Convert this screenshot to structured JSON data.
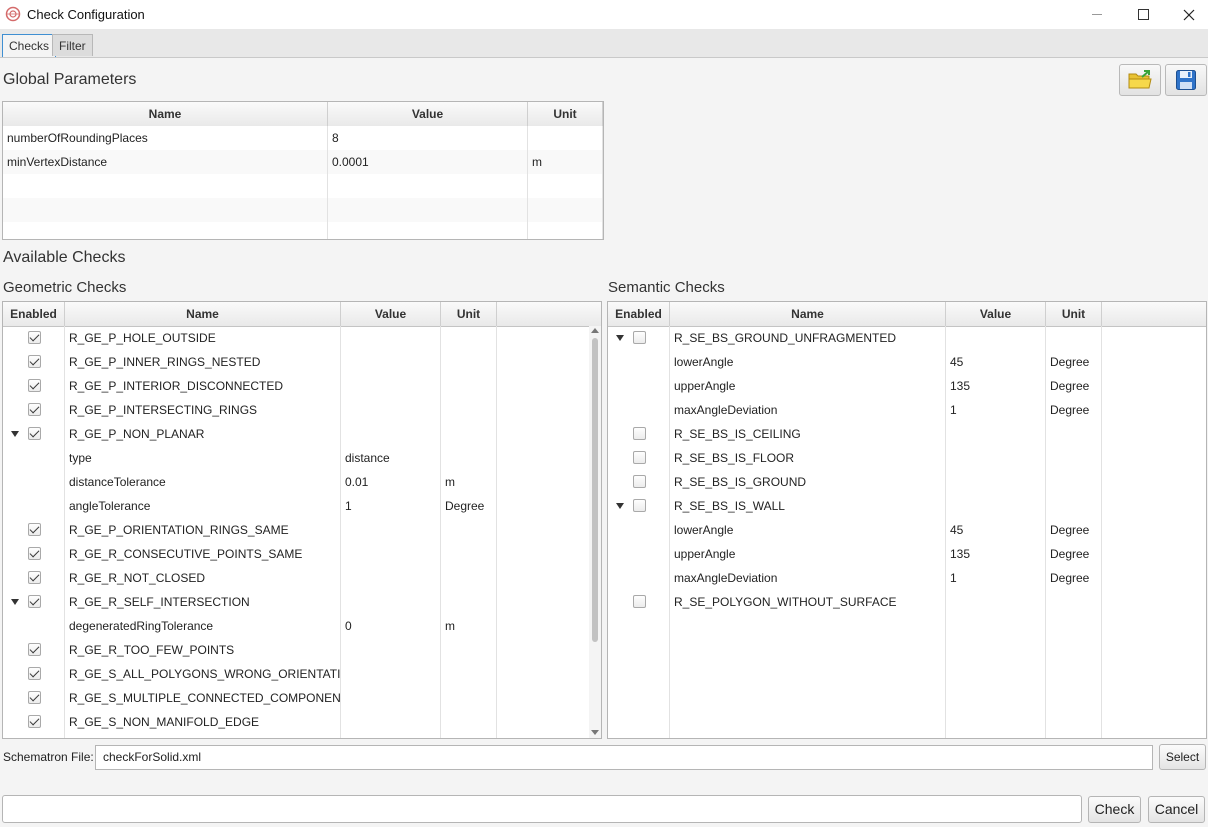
{
  "window": {
    "title": "Check Configuration",
    "minimize_icon": "minimize-icon",
    "maximize_icon": "maximize-icon",
    "close_icon": "close-icon"
  },
  "tabs": [
    {
      "label": "Checks",
      "active": true
    },
    {
      "label": "Filter",
      "active": false
    }
  ],
  "toolbar": {
    "open_icon": "folder-open-icon",
    "save_icon": "save-icon"
  },
  "global": {
    "title": "Global Parameters",
    "columns": [
      "Name",
      "Value",
      "Unit"
    ],
    "rows": [
      {
        "name": "numberOfRoundingPlaces",
        "value": "8",
        "unit": ""
      },
      {
        "name": "minVertexDistance",
        "value": "0.0001",
        "unit": "m"
      }
    ]
  },
  "available_title": "Available Checks",
  "geometric": {
    "title": "Geometric Checks",
    "columns": [
      "Enabled",
      "Name",
      "Value",
      "Unit"
    ],
    "rows": [
      {
        "kind": "check",
        "name": "R_GE_P_HOLE_OUTSIDE",
        "checked": true
      },
      {
        "kind": "check",
        "name": "R_GE_P_INNER_RINGS_NESTED",
        "checked": true
      },
      {
        "kind": "check",
        "name": "R_GE_P_INTERIOR_DISCONNECTED",
        "checked": true
      },
      {
        "kind": "check",
        "name": "R_GE_P_INTERSECTING_RINGS",
        "checked": true
      },
      {
        "kind": "check",
        "name": "R_GE_P_NON_PLANAR",
        "checked": true,
        "expanded": true
      },
      {
        "kind": "param",
        "name": "type",
        "value": "distance",
        "unit": ""
      },
      {
        "kind": "param",
        "name": "distanceTolerance",
        "value": "0.01",
        "unit": "m"
      },
      {
        "kind": "param",
        "name": "angleTolerance",
        "value": "1",
        "unit": "Degree"
      },
      {
        "kind": "check",
        "name": "R_GE_P_ORIENTATION_RINGS_SAME",
        "checked": true
      },
      {
        "kind": "check",
        "name": "R_GE_R_CONSECUTIVE_POINTS_SAME",
        "checked": true
      },
      {
        "kind": "check",
        "name": "R_GE_R_NOT_CLOSED",
        "checked": true
      },
      {
        "kind": "check",
        "name": "R_GE_R_SELF_INTERSECTION",
        "checked": true,
        "expanded": true
      },
      {
        "kind": "param",
        "name": "degeneratedRingTolerance",
        "value": "0",
        "unit": "m"
      },
      {
        "kind": "check",
        "name": "R_GE_R_TOO_FEW_POINTS",
        "checked": true
      },
      {
        "kind": "check",
        "name": "R_GE_S_ALL_POLYGONS_WRONG_ORIENTATION",
        "checked": true
      },
      {
        "kind": "check",
        "name": "R_GE_S_MULTIPLE_CONNECTED_COMPONENTS",
        "checked": true
      },
      {
        "kind": "check",
        "name": "R_GE_S_NON_MANIFOLD_EDGE",
        "checked": true
      }
    ]
  },
  "semantic": {
    "title": "Semantic Checks",
    "columns": [
      "Enabled",
      "Name",
      "Value",
      "Unit"
    ],
    "rows": [
      {
        "kind": "check",
        "name": "R_SE_BS_GROUND_UNFRAGMENTED",
        "checked": false,
        "expanded": true
      },
      {
        "kind": "param",
        "name": "lowerAngle",
        "value": "45",
        "unit": "Degree"
      },
      {
        "kind": "param",
        "name": "upperAngle",
        "value": "135",
        "unit": "Degree"
      },
      {
        "kind": "param",
        "name": "maxAngleDeviation",
        "value": "1",
        "unit": "Degree"
      },
      {
        "kind": "check",
        "name": "R_SE_BS_IS_CEILING",
        "checked": false
      },
      {
        "kind": "check",
        "name": "R_SE_BS_IS_FLOOR",
        "checked": false
      },
      {
        "kind": "check",
        "name": "R_SE_BS_IS_GROUND",
        "checked": false
      },
      {
        "kind": "check",
        "name": "R_SE_BS_IS_WALL",
        "checked": false,
        "expanded": true
      },
      {
        "kind": "param",
        "name": "lowerAngle",
        "value": "45",
        "unit": "Degree"
      },
      {
        "kind": "param",
        "name": "upperAngle",
        "value": "135",
        "unit": "Degree"
      },
      {
        "kind": "param",
        "name": "maxAngleDeviation",
        "value": "1",
        "unit": "Degree"
      },
      {
        "kind": "check",
        "name": "R_SE_POLYGON_WITHOUT_SURFACE",
        "checked": false
      }
    ]
  },
  "schematron": {
    "label": "Schematron File:",
    "value": "checkForSolid.xml",
    "select_label": "Select"
  },
  "footer": {
    "status_value": "",
    "check_label": "Check",
    "cancel_label": "Cancel"
  },
  "colors": {
    "accent": "#3f8fd2",
    "background": "#f4f4f4"
  }
}
